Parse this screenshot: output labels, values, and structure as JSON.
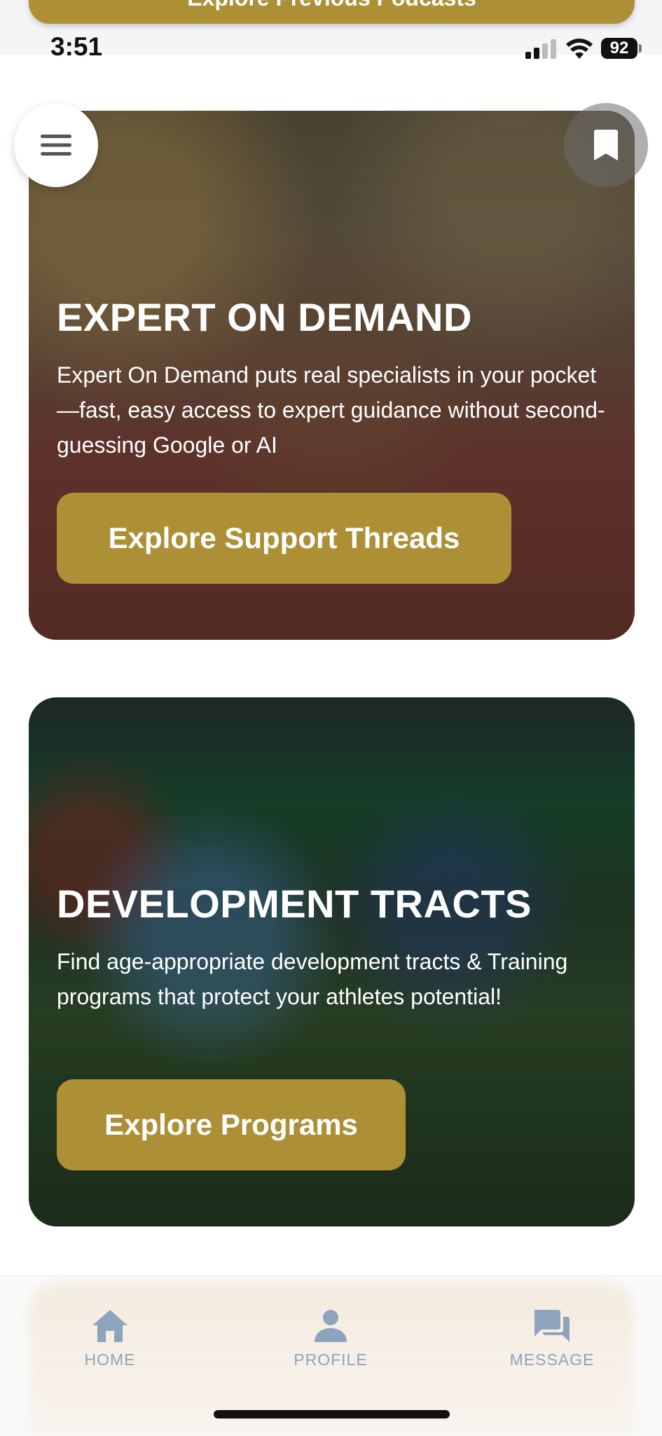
{
  "status_bar": {
    "time": "3:51",
    "battery": "92"
  },
  "top_button": {
    "label": "Explore Previous Podcasts"
  },
  "cards": [
    {
      "title": "EXPERT ON DEMAND",
      "description": "Expert On Demand puts real specialists in your pocket—fast, easy access to expert guidance without second-guessing Google or AI",
      "button_label": "Explore Support Threads"
    },
    {
      "title": "DEVELOPMENT TRACTS",
      "description": "Find age-appropriate development tracts & Training programs that protect your athletes potential!",
      "button_label": "Explore Programs"
    }
  ],
  "tabs": [
    {
      "label": "HOME",
      "icon": "home-icon"
    },
    {
      "label": "PROFILE",
      "icon": "profile-icon"
    },
    {
      "label": "MESSAGE",
      "icon": "message-icon"
    }
  ],
  "colors": {
    "accent": "#ad8f35",
    "tab_inactive": "#8ea4bd"
  }
}
